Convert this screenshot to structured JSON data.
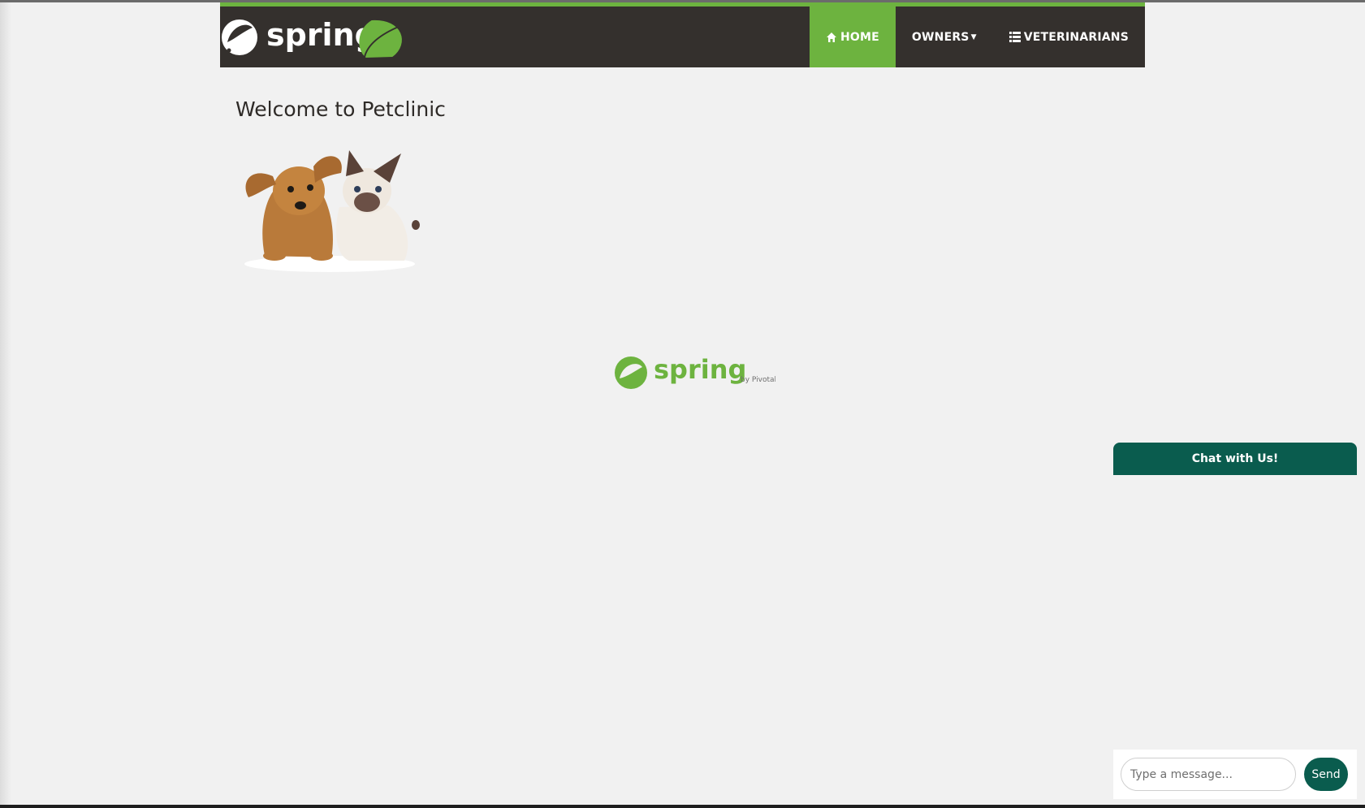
{
  "colors": {
    "brand_green": "#6db33f",
    "navbar_bg": "#34302d",
    "chat_accent": "#0a5c4e",
    "page_bg": "#f1f1f1"
  },
  "header": {
    "logo": {
      "icon": "spring-logo-with-leaf-icon",
      "text": "spring"
    },
    "nav": [
      {
        "label": "HOME",
        "icon": "home-icon",
        "active": true
      },
      {
        "label": "OWNERS",
        "icon": "caret-down-icon",
        "active": false
      },
      {
        "label": "VETERINARIANS",
        "icon": "list-icon",
        "active": false
      }
    ]
  },
  "main": {
    "title": "Welcome to Petclinic",
    "image": "pets-dog-and-cat-image"
  },
  "footer": {
    "logo": {
      "icon": "spring-logo-icon",
      "text": "spring",
      "byline": "by Pivotal."
    }
  },
  "chat": {
    "header": "Chat with Us!",
    "input_placeholder": "Type a message...",
    "send_label": "Send"
  }
}
